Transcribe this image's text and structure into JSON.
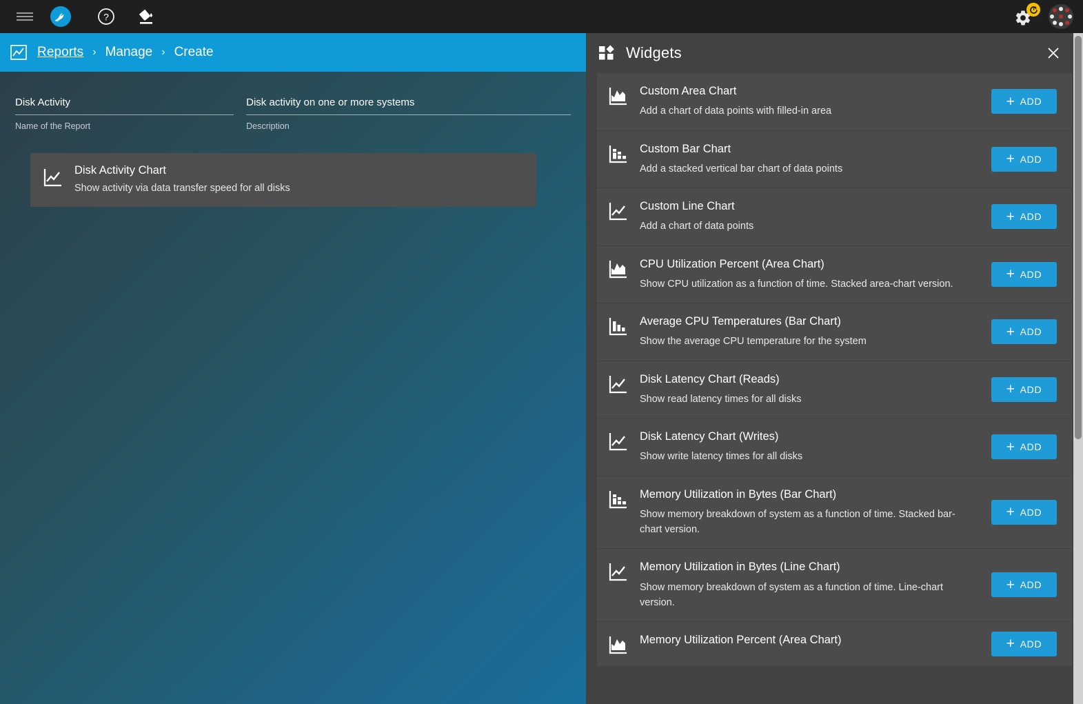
{
  "topbar": {
    "menu_icon": "hamburger-menu-icon",
    "logo_icon": "truenas-logo-icon",
    "help_icon": "help-circle-icon",
    "theme_icon": "paint-bucket-icon",
    "settings_icon": "gear-icon",
    "settings_badge_icon": "update-available-badge-icon",
    "avatar_icon": "user-avatar-icon"
  },
  "breadcrumb": {
    "icon": "report-chart-icon",
    "root": "Reports",
    "separator": "›",
    "middle": "Manage",
    "current": "Create"
  },
  "form": {
    "name": {
      "value": "Disk Activity",
      "label": "Name of the Report",
      "placeholder": "Name of the Report"
    },
    "description": {
      "value": "Disk activity on one or more systems",
      "label": "Description",
      "placeholder": "Description"
    }
  },
  "selected_widget": {
    "icon": "line-chart-icon",
    "title": "Disk Activity Chart",
    "subtitle": "Show activity via data transfer speed for all disks"
  },
  "panel": {
    "icon": "widgets-grid-icon",
    "title": "Widgets",
    "close_icon": "close-icon",
    "add_label": "ADD",
    "add_plus": "+",
    "items": [
      {
        "icon": "area-chart-icon",
        "title": "Custom Area Chart",
        "subtitle": "Add a chart of data points with filled-in area"
      },
      {
        "icon": "stacked-bar-chart-icon",
        "title": "Custom Bar Chart",
        "subtitle": "Add a stacked vertical bar chart of data points"
      },
      {
        "icon": "line-chart-icon",
        "title": "Custom Line Chart",
        "subtitle": "Add a chart of data points"
      },
      {
        "icon": "area-chart-icon",
        "title": "CPU Utilization Percent (Area Chart)",
        "subtitle": "Show CPU utilization as a function of time. Stacked area-chart version."
      },
      {
        "icon": "bar-chart-icon",
        "title": "Average CPU Temperatures (Bar Chart)",
        "subtitle": "Show the average CPU temperature for the system"
      },
      {
        "icon": "line-chart-icon",
        "title": "Disk Latency Chart (Reads)",
        "subtitle": "Show read latency times for all disks"
      },
      {
        "icon": "line-chart-icon",
        "title": "Disk Latency Chart (Writes)",
        "subtitle": "Show write latency times for all disks"
      },
      {
        "icon": "stacked-bar-chart-icon",
        "title": "Memory Utilization in Bytes (Bar Chart)",
        "subtitle": "Show memory breakdown of system as a function of time. Stacked bar-chart version."
      },
      {
        "icon": "line-chart-icon",
        "title": "Memory Utilization in Bytes (Line Chart)",
        "subtitle": "Show memory breakdown of system as a function of time. Line-chart version."
      },
      {
        "icon": "area-chart-icon",
        "title": "Memory Utilization Percent (Area Chart)",
        "subtitle": ""
      }
    ]
  },
  "colors": {
    "accent": "#1f9bd7",
    "breadcrumb_bar": "#0f9bd7",
    "panel_bg": "#424242",
    "row_bg": "#4b4b4b",
    "topbar_bg": "#1f1f1f",
    "badge": "#f6c000"
  }
}
